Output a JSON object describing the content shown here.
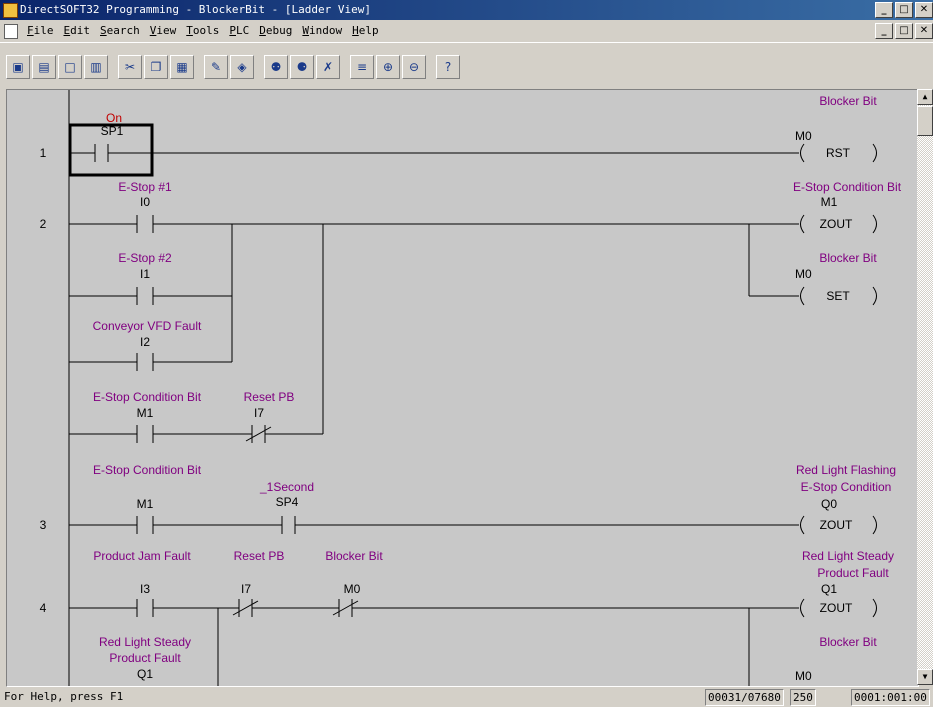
{
  "window": {
    "title": "DirectSOFT32 Programming - BlockerBit - [Ladder View]",
    "min_glyph": "_",
    "max_glyph": "□",
    "close_glyph": "✕"
  },
  "menu": [
    {
      "key": "F",
      "rest": "ile"
    },
    {
      "key": "E",
      "rest": "dit"
    },
    {
      "key": "S",
      "rest": "earch"
    },
    {
      "key": "V",
      "rest": "iew"
    },
    {
      "key": "T",
      "rest": "ools"
    },
    {
      "key": "P",
      "rest": "LC"
    },
    {
      "key": "D",
      "rest": "ebug"
    },
    {
      "key": "W",
      "rest": "indow"
    },
    {
      "key": "H",
      "rest": "elp"
    }
  ],
  "toolbar": [
    {
      "icon": "save-icon",
      "glyph": "▣"
    },
    {
      "icon": "save-all-icon",
      "glyph": "▤"
    },
    {
      "icon": "new-icon",
      "glyph": "□"
    },
    {
      "icon": "open-icon",
      "glyph": "▥"
    },
    {
      "sep": true
    },
    {
      "icon": "cut-icon",
      "glyph": "✂"
    },
    {
      "icon": "copy-icon",
      "glyph": "❐"
    },
    {
      "icon": "paste-icon",
      "glyph": "▦"
    },
    {
      "sep": true
    },
    {
      "icon": "edit-mode-icon",
      "glyph": "✎"
    },
    {
      "icon": "accept-icon",
      "glyph": "◈"
    },
    {
      "sep": true
    },
    {
      "icon": "find-icon",
      "glyph": "⚉"
    },
    {
      "icon": "find-replace-icon",
      "glyph": "⚈"
    },
    {
      "icon": "find-next-icon",
      "glyph": "✗"
    },
    {
      "sep": true
    },
    {
      "icon": "insert-rung-icon",
      "glyph": "≡"
    },
    {
      "icon": "zoom-in-icon",
      "glyph": "⊕"
    },
    {
      "icon": "zoom-out-icon",
      "glyph": "⊖"
    },
    {
      "sep": true
    },
    {
      "icon": "help-icon",
      "glyph": "?"
    }
  ],
  "rungs": {
    "numbers": [
      "1",
      "2",
      "3",
      "4"
    ],
    "r1": {
      "contact_desc": "On",
      "contact_addr": "SP1",
      "coil_desc": "Blocker Bit",
      "coil_addr": "M0",
      "coil_type": "RST"
    },
    "r2": {
      "estop1_desc": "E-Stop #1",
      "estop1_addr": "I0",
      "estop2_desc": "E-Stop #2",
      "estop2_addr": "I1",
      "vfd_desc": "Conveyor VFD Fault",
      "vfd_addr": "I2",
      "m1_desc": "E-Stop Condition Bit",
      "m1_addr": "M1",
      "reset_desc": "Reset PB",
      "reset_addr": "I7",
      "coil1_desc": "E-Stop Condition Bit",
      "coil1_addr": "M1",
      "coil1_type": "ZOUT",
      "coil2_desc": "Blocker Bit",
      "coil2_addr": "M0",
      "coil2_type": "SET"
    },
    "r3": {
      "m1_desc": "E-Stop Condition Bit",
      "m1_addr": "M1",
      "sp4_desc": "_1Second",
      "sp4_addr": "SP4",
      "coil_desc1": "Red Light Flashing",
      "coil_desc2": "E-Stop Condition",
      "coil_addr": "Q0",
      "coil_type": "ZOUT"
    },
    "r4": {
      "i3_desc": "Product Jam Fault",
      "i3_addr": "I3",
      "i7_desc": "Reset PB",
      "i7_addr": "I7",
      "m0_desc": "Blocker Bit",
      "m0_addr": "M0",
      "coil_desc1": "Red Light Steady",
      "coil_desc2": "Product Fault",
      "coil_addr": "Q1",
      "coil_type": "ZOUT",
      "branch_desc1": "Red Light Steady",
      "branch_desc2": "Product Fault",
      "branch_addr": "Q1",
      "coil2_desc": "Blocker Bit",
      "coil2_addr": "M0"
    }
  },
  "status": {
    "help": "For Help, press F1",
    "position": "00031/07680",
    "value": "250",
    "cursor": "0001:001:00"
  },
  "colors": {
    "label": "#800080",
    "background": "#c8c8c8",
    "title_start": "#0a246a"
  }
}
